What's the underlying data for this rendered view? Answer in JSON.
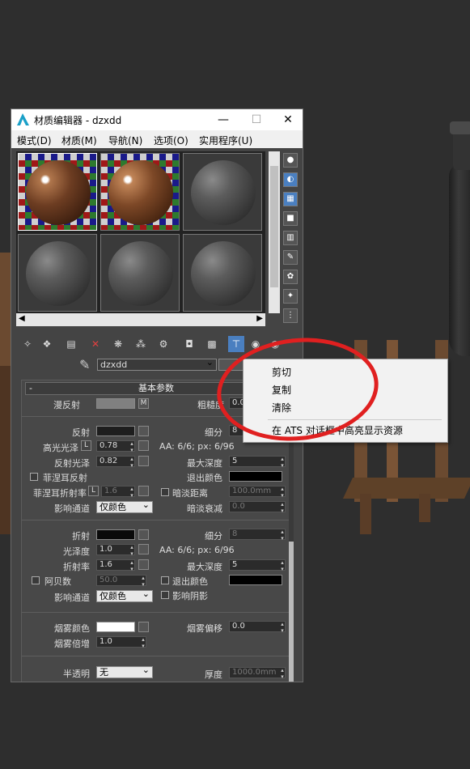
{
  "window": {
    "title": "材质编辑器 - dzxdd",
    "minimize": "—",
    "maximize": "☐",
    "close": "✕"
  },
  "menu": [
    "模式(D)",
    "材质(M)",
    "导航(N)",
    "选项(O)",
    "实用程序(U)"
  ],
  "material_name": "dzxdd",
  "rollout_title": "基本参数",
  "diffuse": {
    "label": "漫反射",
    "map_button": "M",
    "roughness_label": "粗糙度",
    "roughness_value": "0.0"
  },
  "reflect": {
    "label": "反射",
    "subdivs_label": "细分",
    "subdivs_value": "8",
    "hilight_gloss_label": "高光光泽",
    "hilight_lock": "L",
    "hilight_gloss_value": "0.78",
    "aa_text": "AA: 6/6; px: 6/96",
    "refl_gloss_label": "反射光泽",
    "refl_gloss_value": "0.82",
    "max_depth_label": "最大深度",
    "max_depth_value": "5",
    "fresnel_label": "菲涅耳反射",
    "exit_color_label": "退出颜色",
    "fresnel_ior_label": "菲涅耳折射率",
    "fresnel_lock": "L",
    "fresnel_ior_value": "1.6",
    "dim_distance_label": "暗淡距离",
    "dim_distance_value": "100.0mm",
    "affect_channels_label": "影响通道",
    "affect_channels_value": "仅颜色",
    "dim_falloff_label": "暗淡衰减",
    "dim_falloff_value": "0.0"
  },
  "refract": {
    "label": "折射",
    "subdivs_label": "细分",
    "subdivs_value": "8",
    "gloss_label": "光泽度",
    "gloss_value": "1.0",
    "aa_text": "AA: 6/6; px: 6/96",
    "ior_label": "折射率",
    "ior_value": "1.6",
    "max_depth_label": "最大深度",
    "max_depth_value": "5",
    "abbe_label": "阿贝数",
    "abbe_value": "50.0",
    "exit_color_label": "退出颜色",
    "affect_channels_label": "影响通道",
    "affect_channels_value": "仅颜色",
    "affect_shadows_label": "影响阴影"
  },
  "fog": {
    "color_label": "烟雾颜色",
    "bias_label": "烟雾偏移",
    "bias_value": "0.0",
    "multiplier_label": "烟雾倍增",
    "multiplier_value": "1.0"
  },
  "translucency": {
    "label": "半透明",
    "value": "无",
    "thickness_label": "厚度",
    "thickness_value": "1000.0mm"
  },
  "context_menu": {
    "items": [
      "剪切",
      "复制",
      "清除"
    ],
    "ats_item": "在 ATS 对话框中高亮显示资源"
  },
  "colors": {
    "diffuse_swatch": "#808080",
    "reflect_swatch": "#1e1e1e",
    "refract_swatch": "#0a0a0a",
    "exit_swatch": "#000000",
    "fog_swatch": "#ffffff",
    "annotation": "#e02020"
  }
}
